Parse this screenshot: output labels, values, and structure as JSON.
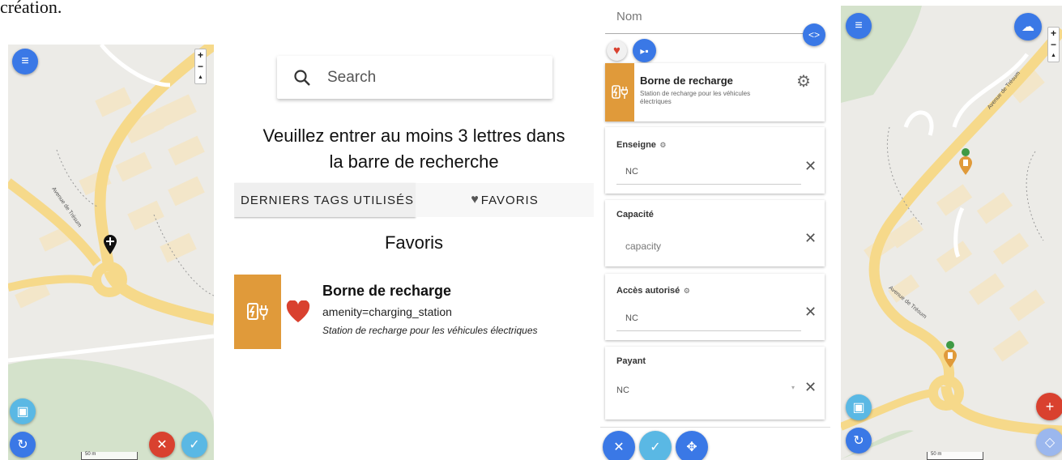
{
  "caption_fragment": "création.",
  "panel1": {
    "zoom_in": "+",
    "zoom_out": "−",
    "compass": "▲",
    "street_label": "Avenue de Trésum",
    "scale_label": "50 m",
    "icons": {
      "menu": "menu-icon",
      "gallery": "image-icon",
      "refresh": "refresh-icon",
      "cancel": "close-icon",
      "confirm": "check-icon",
      "marker": "move-marker-icon"
    }
  },
  "panel2": {
    "search_placeholder": "Search",
    "message_line1": "Veuillez entrer au moins 3 lettres dans",
    "message_line2": "la barre de recherche",
    "tab_recent": "DERNIERS TAGS UTILISÉS",
    "tab_favorites": "FAVORIS",
    "favorites_heading": "Favoris",
    "favorite": {
      "name": "Borne de recharge",
      "tag": "amenity=charging_station",
      "description": "Station de recharge pour les véhicules électriques"
    }
  },
  "panel3": {
    "name_placeholder": "Nom",
    "preset": {
      "name": "Borne de recharge",
      "description_line1": "Station de recharge pour les véhicules",
      "description_line2": "électriques"
    },
    "fields": [
      {
        "label": "Enseigne",
        "value": "NC"
      },
      {
        "label": "Capacité",
        "value": "capacity"
      },
      {
        "label": "Accès autorisé",
        "value": "NC"
      },
      {
        "label": "Payant",
        "value": "NC"
      }
    ],
    "clear_symbol": "✕",
    "accent_color": "#e09a3a"
  },
  "panel4": {
    "zoom_in": "+",
    "zoom_out": "−",
    "compass": "▲",
    "street_label_top": "Avenue de Trésum",
    "street_label_bottom": "Avenue de Trésum",
    "scale_label": "50 m"
  },
  "colors": {
    "blue": "#3a78e6",
    "light_blue": "#5ab8e4",
    "red": "#d9412f",
    "orange": "#e09a3a"
  }
}
